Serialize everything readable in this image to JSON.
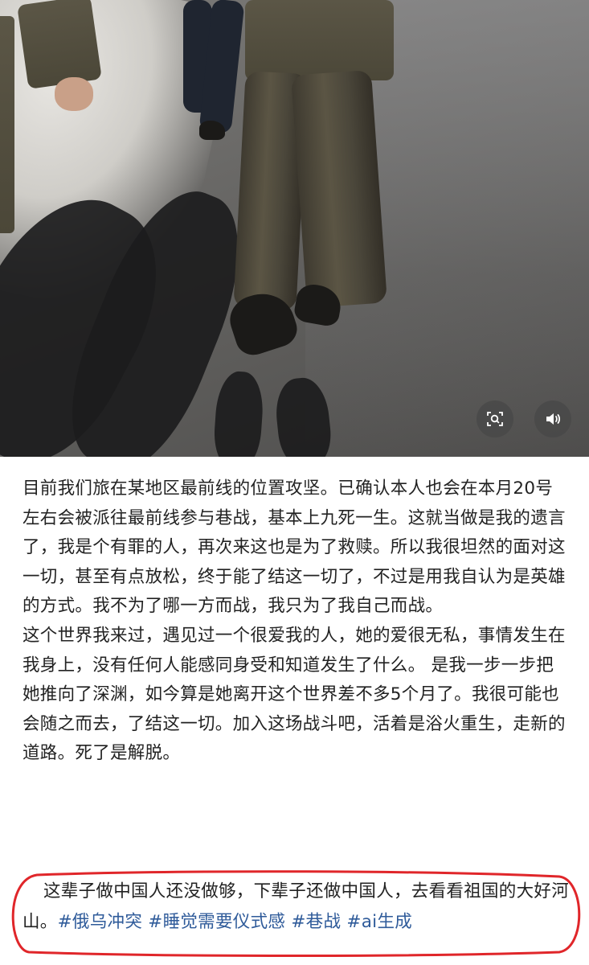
{
  "photo": {
    "icons": {
      "scan": "scan-image-icon",
      "sound": "speaker-icon"
    }
  },
  "article": {
    "paragraphs": [
      "目前我们旅在某地区最前线的位置攻坚。已确认本人也会在本月20号左右会被派往最前线参与巷战，基本上九死一生。这就当做是我的遗言了，我是个有罪的人，再次来这也是为了救赎。所以我很坦然的面对这一切，甚至有点放松，终于能了结这一切了，不过是用我自认为是英雄的方式。我不为了哪一方而战，我只为了我自己而战。",
      "这个世界我来过，遇见过一个很爱我的人，她的爱很无私，事情发生在我身上，没有任何人能感同身受和知道发生了什么。 是我一步一步把她推向了深渊，如今算是她离开这个世界差不多5个月了。我很可能也会随之而去，了结这一切。加入这场战斗吧，活着是浴火重生，走新的道路。死了是解脱。"
    ],
    "highlight": {
      "text": "这辈子做中国人还没做够，下辈子还做中国人，去看看祖国的大好河山。",
      "tags": [
        "#俄乌冲突",
        "#睡觉需要仪式感",
        "#巷战",
        "#ai生成"
      ]
    }
  },
  "colors": {
    "text": "#222222",
    "tag": "#2f5b9a",
    "annotation": "#e0262a"
  }
}
